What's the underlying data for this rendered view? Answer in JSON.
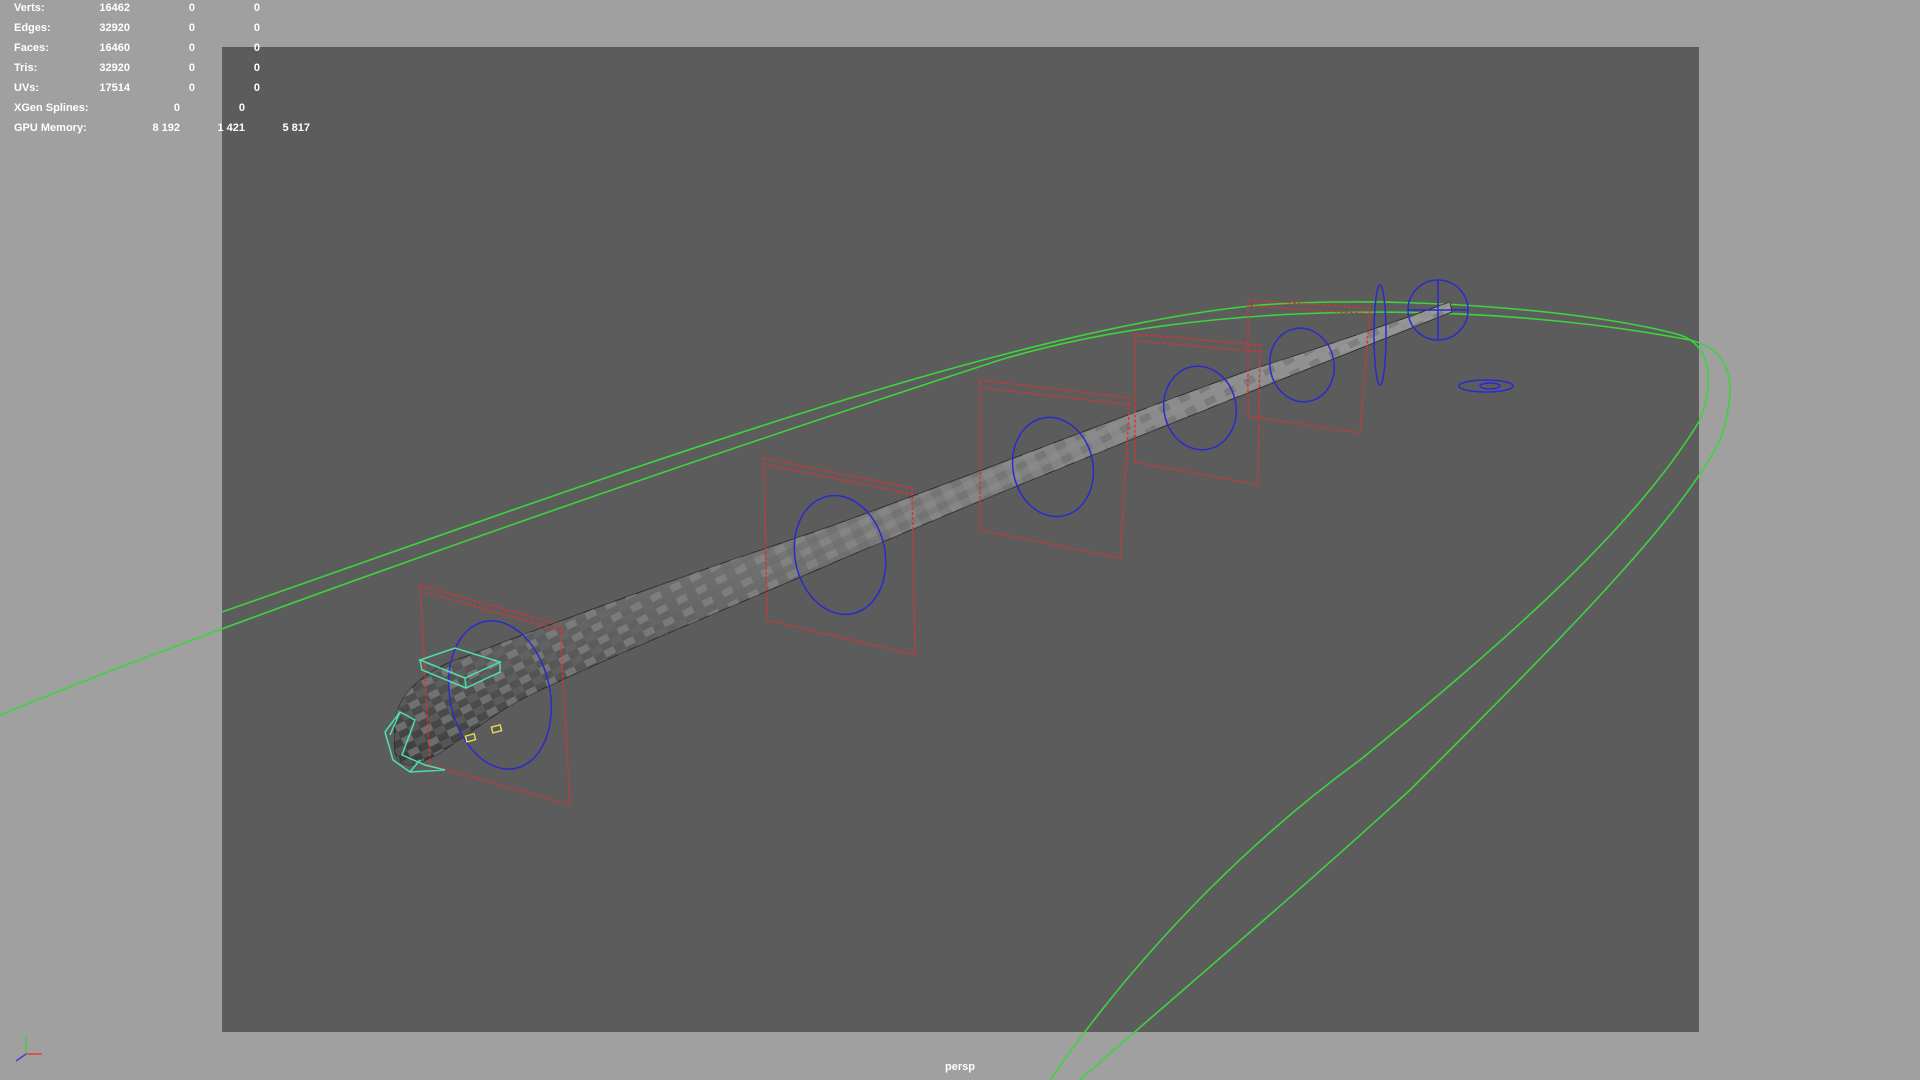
{
  "viewport": {
    "camera_name": "persp",
    "background_color": "#a0a0a0",
    "gate_color": "#5c5c5c"
  },
  "hud": {
    "rows": [
      {
        "label": "Verts:",
        "values": [
          "16462",
          "0",
          "0"
        ]
      },
      {
        "label": "Edges:",
        "values": [
          "32920",
          "0",
          "0"
        ]
      },
      {
        "label": "Faces:",
        "values": [
          "16460",
          "0",
          "0"
        ]
      },
      {
        "label": "Tris:",
        "values": [
          "32920",
          "0",
          "0"
        ]
      },
      {
        "label": "UVs:",
        "values": [
          "17514",
          "0",
          "0"
        ]
      },
      {
        "label": "XGen Splines:",
        "values": [
          "0",
          "0"
        ]
      },
      {
        "label": "GPU Memory:",
        "values": [
          "8 192",
          "1 421",
          "5 817"
        ]
      }
    ]
  },
  "scene": {
    "mesh_name_icon": "snake-mesh",
    "colors": {
      "path_curve": "#3dd43d",
      "fk_controls": "#e03030",
      "ik_controls": "#2a2ad0",
      "head_controls": "#4ee0a8",
      "eye_controls": "#e8e04a"
    }
  },
  "axis_gizmo": {
    "icon": "axis-gizmo-icon",
    "x_color": "#e04040",
    "y_color": "#40d040",
    "z_color": "#4040e0"
  }
}
